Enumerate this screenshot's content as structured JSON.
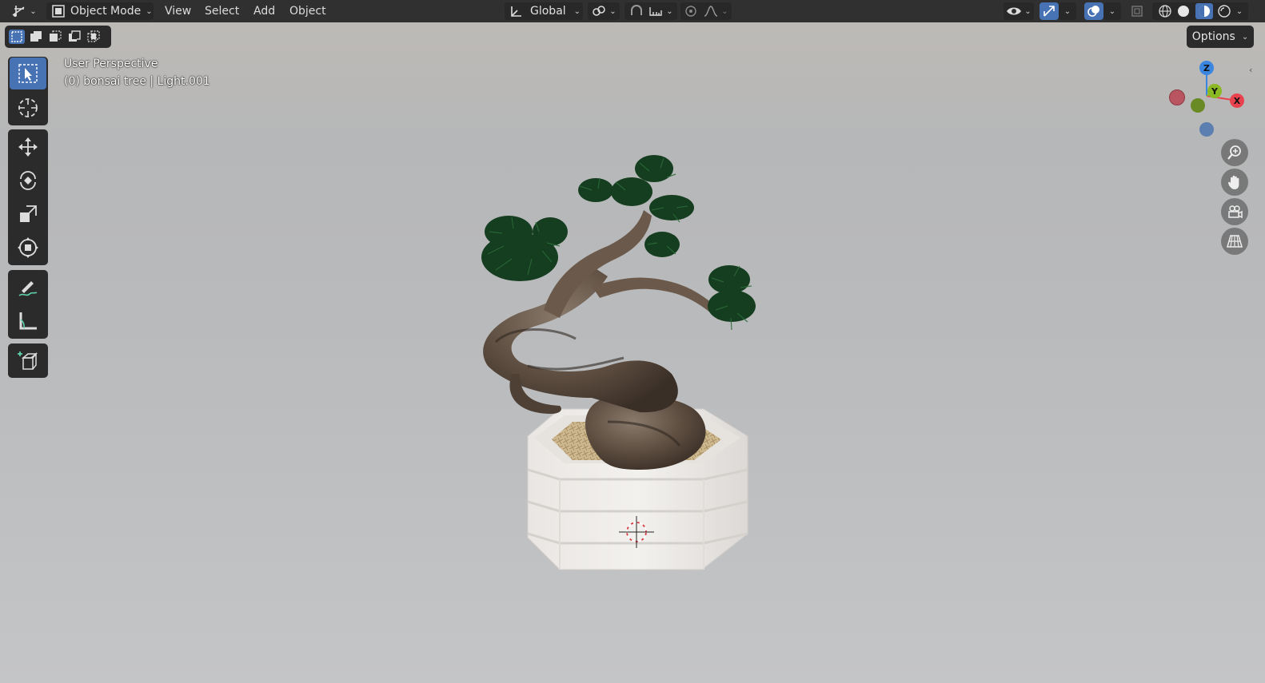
{
  "header": {
    "editor_type_icon": "viewport-editor-icon",
    "mode": "Object Mode",
    "menus": [
      "View",
      "Select",
      "Add",
      "Object"
    ],
    "transform_orientation": "Global"
  },
  "viewport": {
    "options_label": "Options",
    "perspective_label": "User Perspective",
    "object_label": "(0) bonsai tree | Light.001"
  },
  "gizmo": {
    "x": "X",
    "y": "Y",
    "z": "Z",
    "colors": {
      "x": "#e8424e",
      "y": "#8ab923",
      "z": "#3a86e0"
    }
  },
  "colors": {
    "accent": "#4772b3",
    "header_bg": "#303030",
    "panel_bg": "#2b2b2b"
  }
}
